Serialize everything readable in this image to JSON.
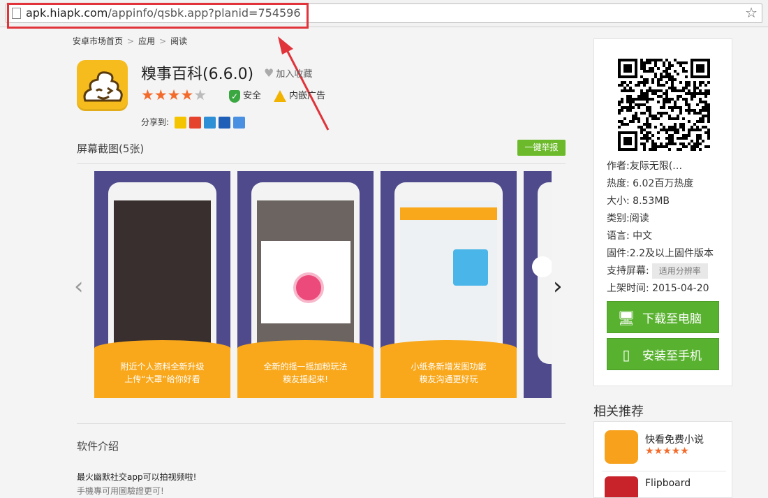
{
  "browser": {
    "url_host": "apk.hiapk.com",
    "url_path": "/appinfo/qsbk.app?planid=754596",
    "bookmark_icon": "star-icon"
  },
  "breadcrumb": [
    "安卓市场首页",
    "应用",
    "阅读"
  ],
  "app": {
    "title": "糗事百科(6.6.0)",
    "favorite_label": "加入收藏",
    "rating": 4,
    "rating_max": 5,
    "safe_label": "安全",
    "ads_label": "内嵌广告",
    "share_label": "分享到:",
    "share_targets": [
      "qzone-icon",
      "weibo-icon",
      "tencent-weibo-icon",
      "renren-icon",
      "more-share-icon"
    ]
  },
  "screenshots": {
    "section_title": "屏幕截图(5张)",
    "report_button": "一键举报",
    "items": [
      {
        "line1": "附近个人资料全新升级",
        "line2": "上传“大罩”给你好看"
      },
      {
        "line1": "全新的摇一摇加粉玩法",
        "line2": "糗友摇起来!"
      },
      {
        "line1": "小纸条新增发图功能",
        "line2": "糗友沟通更好玩"
      }
    ]
  },
  "intro": {
    "title": "软件介绍",
    "line1": "最火幽默社交app可以拍视频啦!",
    "line2": "手機專可用圖驗證更可!"
  },
  "sidebar": {
    "author_label": "作者:",
    "author": "友际无限(…",
    "popularity_label": "热度:",
    "popularity": "6.02百万热度",
    "size_label": "大小:",
    "size": "8.53MB",
    "category_label": "类别:",
    "category": "阅读",
    "language_label": "语言:",
    "language": "中文",
    "firmware_label": "固件:",
    "firmware": "2.2及以上固件版本",
    "screen_label": "支持屏幕:",
    "screen": "适用分辨率",
    "date_label": "上架时间:",
    "date": "2015-04-20",
    "download_pc": "下载至电脑",
    "install_phone": "安装至手机"
  },
  "recommend": {
    "title": "相关推荐",
    "items": [
      {
        "name": "快看免费小说",
        "rating": 4.5
      },
      {
        "name": "Flipboard"
      }
    ]
  },
  "colors": {
    "highlight": "#e0333a",
    "green": "#59b22f",
    "orange_star": "#f36b2b",
    "caption_bg": "#f9a81c",
    "screenshot_bg": "#4e4a8c"
  }
}
